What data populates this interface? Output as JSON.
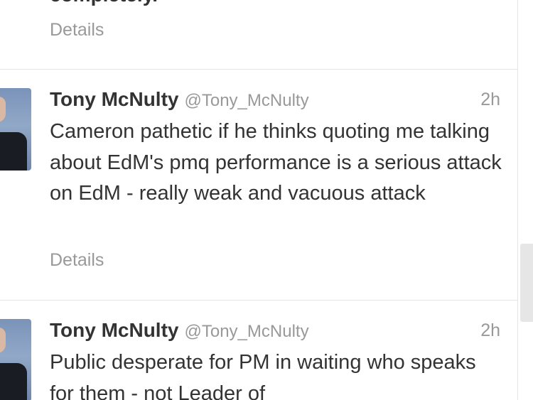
{
  "timeline": {
    "tweets": [
      {
        "partial_text": "completely.",
        "details_label": "Details"
      },
      {
        "fullname": "Tony McNulty",
        "username": "@Tony_McNulty",
        "time": "2h",
        "text": "Cameron pathetic if he thinks quoting me talking about EdM's pmq performance is a serious attack on EdM - really weak and vacuous attack",
        "details_label": "Details"
      },
      {
        "fullname": "Tony McNulty",
        "username": "@Tony_McNulty",
        "time": "2h",
        "text": "Public desperate for PM in waiting who speaks for them - not Leader of"
      }
    ]
  },
  "colors": {
    "text_primary": "#333333",
    "text_secondary": "#999999",
    "divider": "#e4e4e4",
    "scrollbar": "#e6e6e6"
  },
  "icons": {
    "avatar": "profile-photo"
  }
}
